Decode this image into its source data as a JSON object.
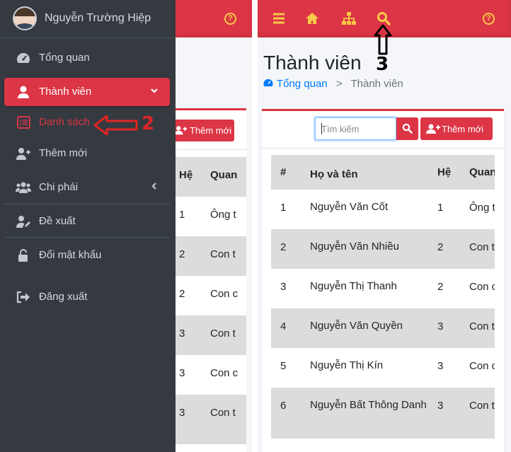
{
  "sidebar": {
    "user_name": "Nguyễn Trường Hiệp",
    "items": [
      {
        "label": "Tổng quan",
        "icon": "tachometer-icon"
      },
      {
        "label": "Thành viên",
        "icon": "user-icon",
        "active": true
      },
      {
        "label": "Danh sách",
        "icon": "list-icon",
        "sub": true
      },
      {
        "label": "Thêm mới",
        "icon": "user-plus-icon"
      },
      {
        "label": "Chi phái",
        "icon": "users-icon"
      },
      {
        "label": "Đề xuất",
        "icon": "user-edit-icon"
      },
      {
        "label": "Đổi mật khẩu",
        "icon": "unlock-icon"
      },
      {
        "label": "Đăng xuất",
        "icon": "sign-out-icon"
      }
    ]
  },
  "left_content": {
    "add_label": "Thêm mới",
    "col_he": "Hệ",
    "col_quan": "Quan",
    "rows": [
      {
        "he": "1",
        "rel": "Ông t"
      },
      {
        "he": "2",
        "rel": "Con t"
      },
      {
        "he": "2",
        "rel": "Con c"
      },
      {
        "he": "3",
        "rel": "Con t"
      },
      {
        "he": "3",
        "rel": "Con c"
      },
      {
        "he": "3",
        "rel": "Con t"
      }
    ]
  },
  "right": {
    "page_title": "Thành viên",
    "breadcrumb_home": "Tổng quan",
    "breadcrumb_sep": ">",
    "breadcrumb_current": "Thành viên",
    "search_placeholder": "Tìm kiếm",
    "add_label": "Thêm mới",
    "table": {
      "headers": {
        "num": "#",
        "name": "Họ và tên",
        "gen": "Hệ",
        "rel": "Quan"
      },
      "rows": [
        {
          "num": "1",
          "name": "Nguyễn Văn Cốt",
          "gen": "1",
          "rel": "Ông t"
        },
        {
          "num": "2",
          "name": "Nguyễn Văn Nhiều",
          "gen": "2",
          "rel": "Con t"
        },
        {
          "num": "3",
          "name": "Nguyễn Thị Thanh",
          "gen": "2",
          "rel": "Con c"
        },
        {
          "num": "4",
          "name": "Nguyễn Văn Quyền",
          "gen": "3",
          "rel": "Con t"
        },
        {
          "num": "5",
          "name": "Nguyễn Thị Kín",
          "gen": "3",
          "rel": "Con c"
        },
        {
          "num": "6",
          "name": "Nguyễn Bất Thông Danh",
          "gen": "3",
          "rel": "Con t"
        }
      ]
    }
  },
  "annotations": {
    "step2": "2",
    "step3": "3",
    "step2_color": "#e02424",
    "step3_color": "#000000"
  },
  "colors": {
    "accent": "#dc3545",
    "sidebar_bg": "#343a40",
    "topbar_icon": "#f7c948",
    "link": "#007bff"
  }
}
